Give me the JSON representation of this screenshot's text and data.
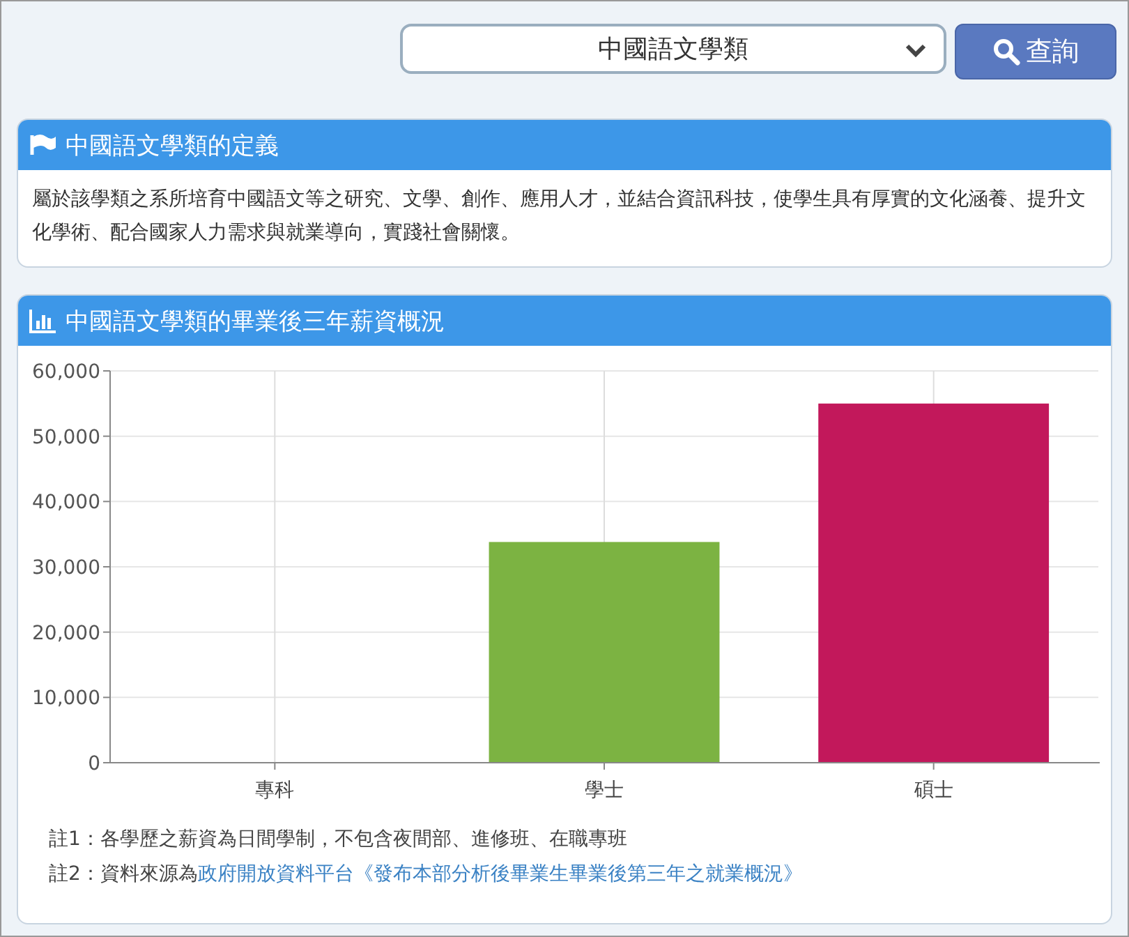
{
  "search": {
    "value": "中國語文學類",
    "button": "查詢"
  },
  "definition": {
    "title": "中國語文學類的定義",
    "text": "屬於該學類之系所培育中國語文等之研究、文學、創作、應用人才，並結合資訊科技，使學生具有厚實的文化涵養、提升文化學術、配合國家人力需求與就業導向，實踐社會關懷。"
  },
  "salary": {
    "title": "中國語文學類的畢業後三年薪資概況",
    "chart_data": {
      "type": "bar",
      "categories": [
        "專科",
        "學士",
        "碩士"
      ],
      "series": [
        {
          "color": "#7cb342",
          "values": [
            null,
            33800,
            null
          ]
        },
        {
          "color": "#c2185b",
          "values": [
            null,
            null,
            55000
          ]
        }
      ],
      "grid": true,
      "ylim": [
        0,
        60000
      ],
      "yticks": [
        {
          "value": 0,
          "label": "0"
        },
        {
          "value": 10000,
          "label": "10,000"
        },
        {
          "value": 20000,
          "label": "20,000"
        },
        {
          "value": 30000,
          "label": "30,000"
        },
        {
          "value": 40000,
          "label": "40,000"
        },
        {
          "value": 50000,
          "label": "50,000"
        },
        {
          "value": 60000,
          "label": "60,000"
        }
      ]
    },
    "notes": [
      {
        "text": "註1：各學歷之薪資為日間學制，不包含夜間部、進修班、在職專班"
      },
      {
        "text": "註2：資料來源為",
        "link": "政府開放資料平台《發布本部分析後畢業生畢業後第三年之就業概況》"
      }
    ]
  }
}
